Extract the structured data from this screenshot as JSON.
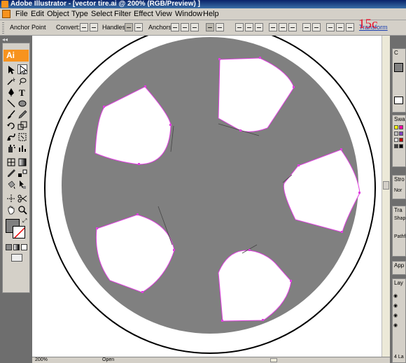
{
  "window": {
    "title": "Adobe Illustrator - [vector tire.ai @ 200% (RGB/Preview) ]"
  },
  "menu": {
    "items": [
      "File",
      "Edit",
      "Object",
      "Type",
      "Select",
      "Filter",
      "Effect",
      "View",
      "Window",
      "Help"
    ]
  },
  "control_bar": {
    "anchor_point_label": "Anchor Point",
    "convert_label": "Convert:",
    "handles_label": "Handles:",
    "anchors_label": "Anchors:",
    "transform_label": "Transform"
  },
  "overlay": {
    "step_label": "15c"
  },
  "tools_panel": {
    "logo": "Ai",
    "collapse_glyph": "◂◂"
  },
  "status_bar": {
    "zoom": "200%",
    "status": "Open"
  },
  "right_panels": {
    "color_tab": "C",
    "swatches_tab": "Swa",
    "stroke_tab": "Stro",
    "stroke_value": "Nor",
    "transparency_tab": "Tra",
    "shape_modes": "Shap",
    "pathfinders": "Pathf",
    "appearance_tab": "App",
    "layers_tab": "Lay",
    "layers_count": "4 La"
  },
  "colors": {
    "tire_gray": "#808080",
    "selection_magenta": "#e040e0",
    "ui_gray": "#d4d0c8",
    "workspace": "#6e6e6e",
    "overlay_red": "#e8102a",
    "ai_orange": "#f7931e"
  }
}
